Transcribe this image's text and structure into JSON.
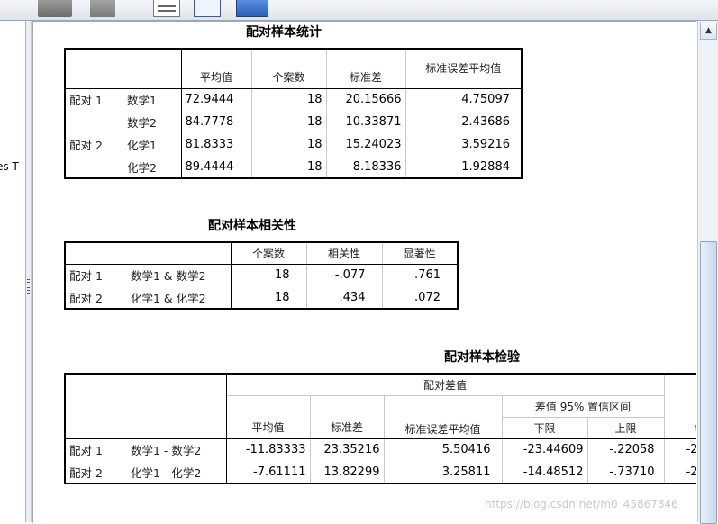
{
  "left_pane": {
    "truncated_text": "es T"
  },
  "table1": {
    "title": "配对样本统计",
    "headers": [
      "平均值",
      "个案数",
      "标准差",
      "标准误差平均值"
    ],
    "rows": [
      {
        "pair": "配对 1",
        "var": "数学1",
        "mean": "72.9444",
        "n": "18",
        "sd": "20.15666",
        "se": "4.75097"
      },
      {
        "pair": "",
        "var": "数学2",
        "mean": "84.7778",
        "n": "18",
        "sd": "10.33871",
        "se": "2.43686"
      },
      {
        "pair": "配对 2",
        "var": "化学1",
        "mean": "81.8333",
        "n": "18",
        "sd": "15.24023",
        "se": "3.59216"
      },
      {
        "pair": "",
        "var": "化学2",
        "mean": "89.4444",
        "n": "18",
        "sd": "8.18336",
        "se": "1.92884"
      }
    ]
  },
  "table2": {
    "title": "配对样本相关性",
    "headers": [
      "个案数",
      "相关性",
      "显著性"
    ],
    "rows": [
      {
        "pair": "配对 1",
        "var": "数学1 & 数学2",
        "n": "18",
        "r": "-.077",
        "sig": ".761"
      },
      {
        "pair": "配对 2",
        "var": "化学1 & 化学2",
        "n": "18",
        "r": ".434",
        "sig": ".072"
      }
    ]
  },
  "table3": {
    "title": "配对样本检验",
    "group_header": "配对差值",
    "headers": {
      "mean": "平均值",
      "sd": "标准差",
      "se": "标准误差平均值",
      "ci": "差值 95% 置信区间",
      "lower": "下限",
      "upper": "上限",
      "t": "t"
    },
    "rows": [
      {
        "pair": "配对 1",
        "var": "数学1 - 数学2",
        "mean": "-11.83333",
        "sd": "23.35216",
        "se": "5.50416",
        "lower": "-23.44609",
        "upper": "-.22058",
        "t": "-2"
      },
      {
        "pair": "配对 2",
        "var": "化学1 - 化学2",
        "mean": "-7.61111",
        "sd": "13.82299",
        "se": "3.25811",
        "lower": "-14.48512",
        "upper": "-.73710",
        "t": "-2"
      }
    ]
  },
  "watermark": "https://blog.csdn.net/m0_45867846",
  "icons": [
    "toolbar-icon",
    "scroll-up-icon",
    "splitter-grip-icon"
  ],
  "colors": {
    "table_border": "#000000",
    "grid_line": "#c8c8c8",
    "toolbar": "#e4e9ef",
    "scroll_thumb": "#c9d8ec"
  }
}
